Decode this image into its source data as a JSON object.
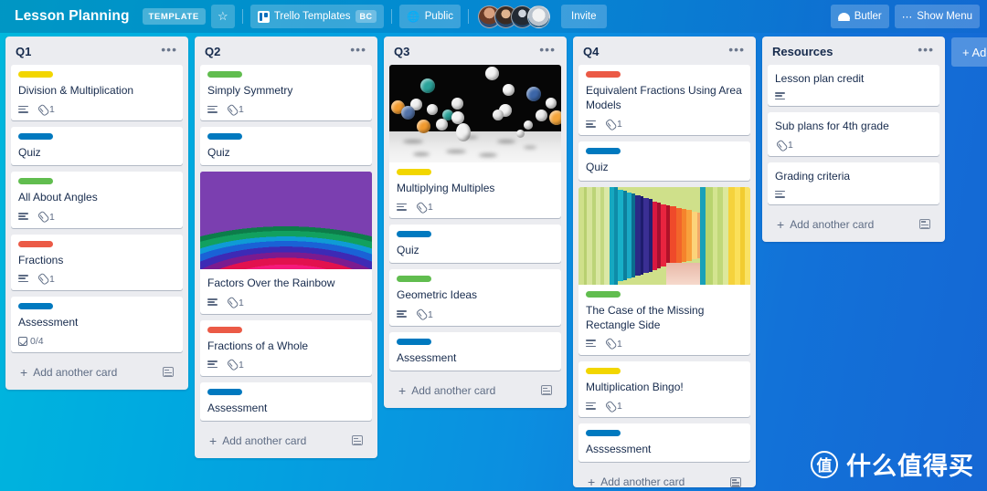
{
  "header": {
    "board_title": "Lesson Planning",
    "template_badge": "TEMPLATE",
    "star_icon": "star-icon",
    "workspace_name": "Trello Templates",
    "workspace_initials": "BC",
    "visibility": "Public",
    "visibility_icon": "globe-icon",
    "invite_label": "Invite",
    "butler_label": "Butler",
    "butler_icon": "butler-hat-icon",
    "show_menu_label": "Show Menu",
    "show_menu_icon": "ellipsis-icon",
    "members": [
      "member-avatar-1",
      "member-avatar-2",
      "member-avatar-3",
      "member-avatar-4"
    ]
  },
  "board": {
    "add_list_label": "+ Add",
    "add_card_label": "Add another card",
    "card_template_icon": "card-template-icon",
    "list_menu_icon": "ellipsis-icon",
    "label_colors": {
      "yellow": "#f2d600",
      "blue": "#0079bf",
      "green": "#61bd4f",
      "red": "#eb5a46"
    },
    "lists": [
      {
        "title": "Q1",
        "cards": [
          {
            "title": "Division & Multiplication",
            "label": "yellow",
            "has_description": true,
            "attachments": "1"
          },
          {
            "title": "Quiz",
            "label": "blue",
            "has_description": false
          },
          {
            "title": "All About Angles",
            "label": "green",
            "has_description": true,
            "attachments": "1"
          },
          {
            "title": "Fractions",
            "label": "red",
            "has_description": true,
            "attachments": "1"
          },
          {
            "title": "Assessment",
            "label": "blue",
            "checklist": "0/4"
          }
        ]
      },
      {
        "title": "Q2",
        "cards": [
          {
            "title": "Simply Symmetry",
            "label": "green",
            "has_description": true,
            "attachments": "1"
          },
          {
            "title": "Quiz",
            "label": "blue",
            "has_description": false
          },
          {
            "title": "Factors Over the Rainbow",
            "cover": "rainbow-arcs-cover",
            "has_description": true,
            "attachments": "1"
          },
          {
            "title": "Fractions of a Whole",
            "label": "red",
            "has_description": true,
            "attachments": "1"
          },
          {
            "title": "Assessment",
            "label": "blue",
            "has_description": false
          }
        ]
      },
      {
        "title": "Q3",
        "cards": [
          {
            "title": "Multiplying Multiples",
            "cover": "bouncing-spheres-cover",
            "label": "yellow",
            "has_description": true,
            "attachments": "1"
          },
          {
            "title": "Quiz",
            "label": "blue",
            "has_description": false
          },
          {
            "title": "Geometric Ideas",
            "label": "green",
            "has_description": true,
            "attachments": "1"
          },
          {
            "title": "Assessment",
            "label": "blue",
            "has_description": false
          }
        ]
      },
      {
        "title": "Q4",
        "cards": [
          {
            "title": "Equivalent Fractions Using Area Models",
            "label": "red",
            "has_description": true,
            "attachments": "1"
          },
          {
            "title": "Quiz",
            "label": "blue",
            "has_description": false
          },
          {
            "title": "The Case of the Missing Rectangle Side",
            "cover": "colorful-corridor-cover",
            "label": "green",
            "has_description": true,
            "attachments": "1"
          },
          {
            "title": "Multiplication Bingo!",
            "label": "yellow",
            "has_description": true,
            "attachments": "1"
          },
          {
            "title": "Asssessment",
            "label": "blue",
            "has_description": false
          }
        ]
      },
      {
        "title": "Resources",
        "cards": [
          {
            "title": "Lesson plan credit",
            "has_description": true
          },
          {
            "title": "Sub plans for 4th grade",
            "attachments": "1"
          },
          {
            "title": "Grading criteria",
            "has_description": true
          }
        ]
      }
    ]
  },
  "watermark": {
    "logo_char": "值",
    "text": "什么值得买"
  }
}
